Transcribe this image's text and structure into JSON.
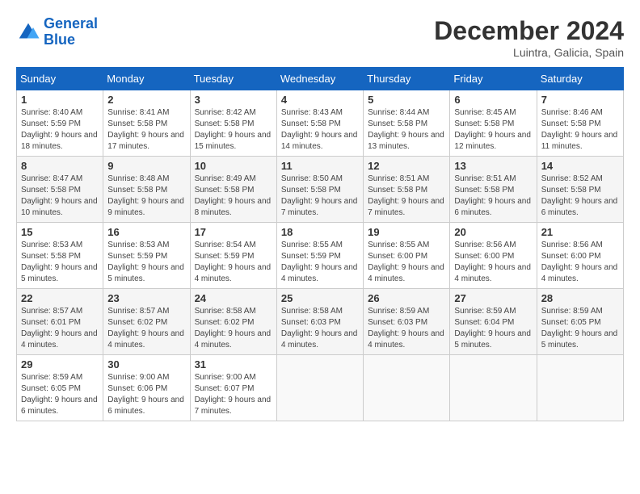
{
  "header": {
    "logo_line1": "General",
    "logo_line2": "Blue",
    "month_title": "December 2024",
    "location": "Luintra, Galicia, Spain"
  },
  "weekdays": [
    "Sunday",
    "Monday",
    "Tuesday",
    "Wednesday",
    "Thursday",
    "Friday",
    "Saturday"
  ],
  "weeks": [
    [
      {
        "day": "1",
        "sunrise": "8:40 AM",
        "sunset": "5:59 PM",
        "daylight": "9 hours and 18 minutes."
      },
      {
        "day": "2",
        "sunrise": "8:41 AM",
        "sunset": "5:58 PM",
        "daylight": "9 hours and 17 minutes."
      },
      {
        "day": "3",
        "sunrise": "8:42 AM",
        "sunset": "5:58 PM",
        "daylight": "9 hours and 15 minutes."
      },
      {
        "day": "4",
        "sunrise": "8:43 AM",
        "sunset": "5:58 PM",
        "daylight": "9 hours and 14 minutes."
      },
      {
        "day": "5",
        "sunrise": "8:44 AM",
        "sunset": "5:58 PM",
        "daylight": "9 hours and 13 minutes."
      },
      {
        "day": "6",
        "sunrise": "8:45 AM",
        "sunset": "5:58 PM",
        "daylight": "9 hours and 12 minutes."
      },
      {
        "day": "7",
        "sunrise": "8:46 AM",
        "sunset": "5:58 PM",
        "daylight": "9 hours and 11 minutes."
      }
    ],
    [
      {
        "day": "8",
        "sunrise": "8:47 AM",
        "sunset": "5:58 PM",
        "daylight": "9 hours and 10 minutes."
      },
      {
        "day": "9",
        "sunrise": "8:48 AM",
        "sunset": "5:58 PM",
        "daylight": "9 hours and 9 minutes."
      },
      {
        "day": "10",
        "sunrise": "8:49 AM",
        "sunset": "5:58 PM",
        "daylight": "9 hours and 8 minutes."
      },
      {
        "day": "11",
        "sunrise": "8:50 AM",
        "sunset": "5:58 PM",
        "daylight": "9 hours and 7 minutes."
      },
      {
        "day": "12",
        "sunrise": "8:51 AM",
        "sunset": "5:58 PM",
        "daylight": "9 hours and 7 minutes."
      },
      {
        "day": "13",
        "sunrise": "8:51 AM",
        "sunset": "5:58 PM",
        "daylight": "9 hours and 6 minutes."
      },
      {
        "day": "14",
        "sunrise": "8:52 AM",
        "sunset": "5:58 PM",
        "daylight": "9 hours and 6 minutes."
      }
    ],
    [
      {
        "day": "15",
        "sunrise": "8:53 AM",
        "sunset": "5:58 PM",
        "daylight": "9 hours and 5 minutes."
      },
      {
        "day": "16",
        "sunrise": "8:53 AM",
        "sunset": "5:59 PM",
        "daylight": "9 hours and 5 minutes."
      },
      {
        "day": "17",
        "sunrise": "8:54 AM",
        "sunset": "5:59 PM",
        "daylight": "9 hours and 4 minutes."
      },
      {
        "day": "18",
        "sunrise": "8:55 AM",
        "sunset": "5:59 PM",
        "daylight": "9 hours and 4 minutes."
      },
      {
        "day": "19",
        "sunrise": "8:55 AM",
        "sunset": "6:00 PM",
        "daylight": "9 hours and 4 minutes."
      },
      {
        "day": "20",
        "sunrise": "8:56 AM",
        "sunset": "6:00 PM",
        "daylight": "9 hours and 4 minutes."
      },
      {
        "day": "21",
        "sunrise": "8:56 AM",
        "sunset": "6:00 PM",
        "daylight": "9 hours and 4 minutes."
      }
    ],
    [
      {
        "day": "22",
        "sunrise": "8:57 AM",
        "sunset": "6:01 PM",
        "daylight": "9 hours and 4 minutes."
      },
      {
        "day": "23",
        "sunrise": "8:57 AM",
        "sunset": "6:02 PM",
        "daylight": "9 hours and 4 minutes."
      },
      {
        "day": "24",
        "sunrise": "8:58 AM",
        "sunset": "6:02 PM",
        "daylight": "9 hours and 4 minutes."
      },
      {
        "day": "25",
        "sunrise": "8:58 AM",
        "sunset": "6:03 PM",
        "daylight": "9 hours and 4 minutes."
      },
      {
        "day": "26",
        "sunrise": "8:59 AM",
        "sunset": "6:03 PM",
        "daylight": "9 hours and 4 minutes."
      },
      {
        "day": "27",
        "sunrise": "8:59 AM",
        "sunset": "6:04 PM",
        "daylight": "9 hours and 5 minutes."
      },
      {
        "day": "28",
        "sunrise": "8:59 AM",
        "sunset": "6:05 PM",
        "daylight": "9 hours and 5 minutes."
      }
    ],
    [
      {
        "day": "29",
        "sunrise": "8:59 AM",
        "sunset": "6:05 PM",
        "daylight": "9 hours and 6 minutes."
      },
      {
        "day": "30",
        "sunrise": "9:00 AM",
        "sunset": "6:06 PM",
        "daylight": "9 hours and 6 minutes."
      },
      {
        "day": "31",
        "sunrise": "9:00 AM",
        "sunset": "6:07 PM",
        "daylight": "9 hours and 7 minutes."
      },
      null,
      null,
      null,
      null
    ]
  ]
}
